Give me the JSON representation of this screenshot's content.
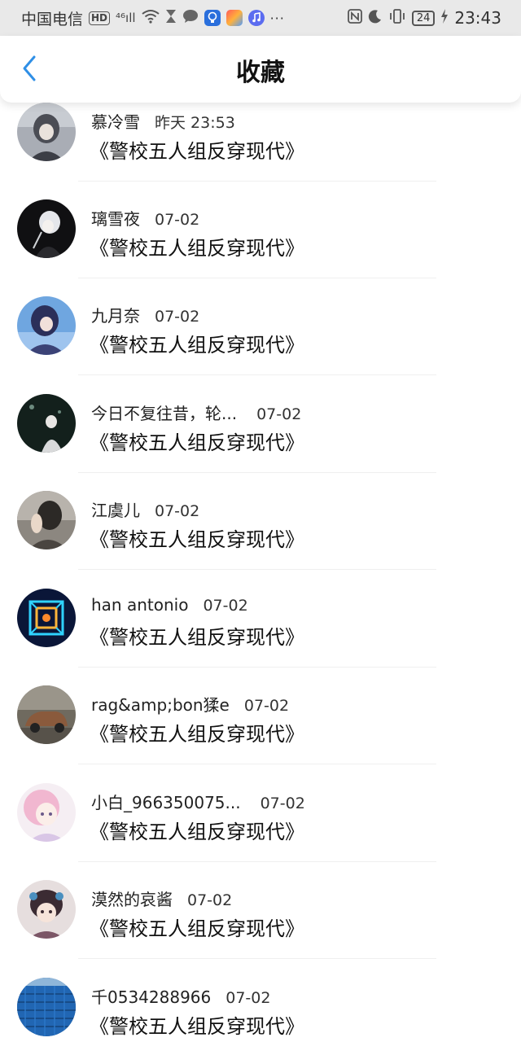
{
  "status_bar": {
    "carrier": "中国电信",
    "hd": "HD",
    "signal": "⁴⁶ıll",
    "battery": "24",
    "time": "23:43",
    "icons": [
      "wifi-icon",
      "hourglass-icon",
      "chat-bubble-icon",
      "lightbulb-app-icon",
      "puzzle-app-icon",
      "music-app-icon",
      "more-dots-icon",
      "nfc-icon",
      "moon-icon",
      "vibrate-icon",
      "battery-icon",
      "charging-icon"
    ]
  },
  "navbar": {
    "title": "收藏",
    "back_icon": "chevron-left-icon",
    "accent": "#2f8fe6"
  },
  "items": [
    {
      "user": "慕冷雪",
      "date": "昨天 23:53",
      "title": "《警校五人组反穿现代》"
    },
    {
      "user": "璃雪夜",
      "date": "07-02",
      "title": "《警校五人组反穿现代》"
    },
    {
      "user": "九月奈",
      "date": "07-02",
      "title": "《警校五人组反穿现代》"
    },
    {
      "user": "今日不复往昔，轮...",
      "date": "07-02",
      "title": "《警校五人组反穿现代》"
    },
    {
      "user": "江虞儿",
      "date": "07-02",
      "title": "《警校五人组反穿现代》"
    },
    {
      "user": "han antonio",
      "date": "07-02",
      "title": "《警校五人组反穿现代》"
    },
    {
      "user": "rag&amp;bon猱e",
      "date": "07-02",
      "title": "《警校五人组反穿现代》"
    },
    {
      "user": "小白_966350075...",
      "date": "07-02",
      "title": "《警校五人组反穿现代》"
    },
    {
      "user": "漠然的哀酱",
      "date": "07-02",
      "title": "《警校五人组反穿现代》"
    },
    {
      "user": "千0534288966",
      "date": "07-02",
      "title": "《警校五人组反穿现代》"
    }
  ]
}
